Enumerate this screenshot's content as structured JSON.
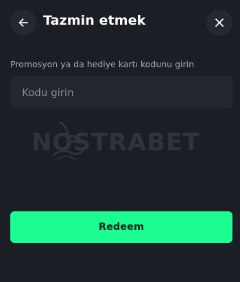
{
  "header": {
    "title": "Tazmin etmek",
    "back_icon": "arrow-left-icon",
    "close_icon": "close-icon"
  },
  "form": {
    "label": "Promosyon ya da hediye kartı kodunu girin",
    "input_placeholder": "Kodu girin",
    "input_value": "",
    "submit_label": "Redeem"
  },
  "watermark": {
    "text": "NOSTRABET"
  },
  "colors": {
    "background": "#1b1e25",
    "input_background": "#23262d",
    "accent": "#1bfd92"
  }
}
